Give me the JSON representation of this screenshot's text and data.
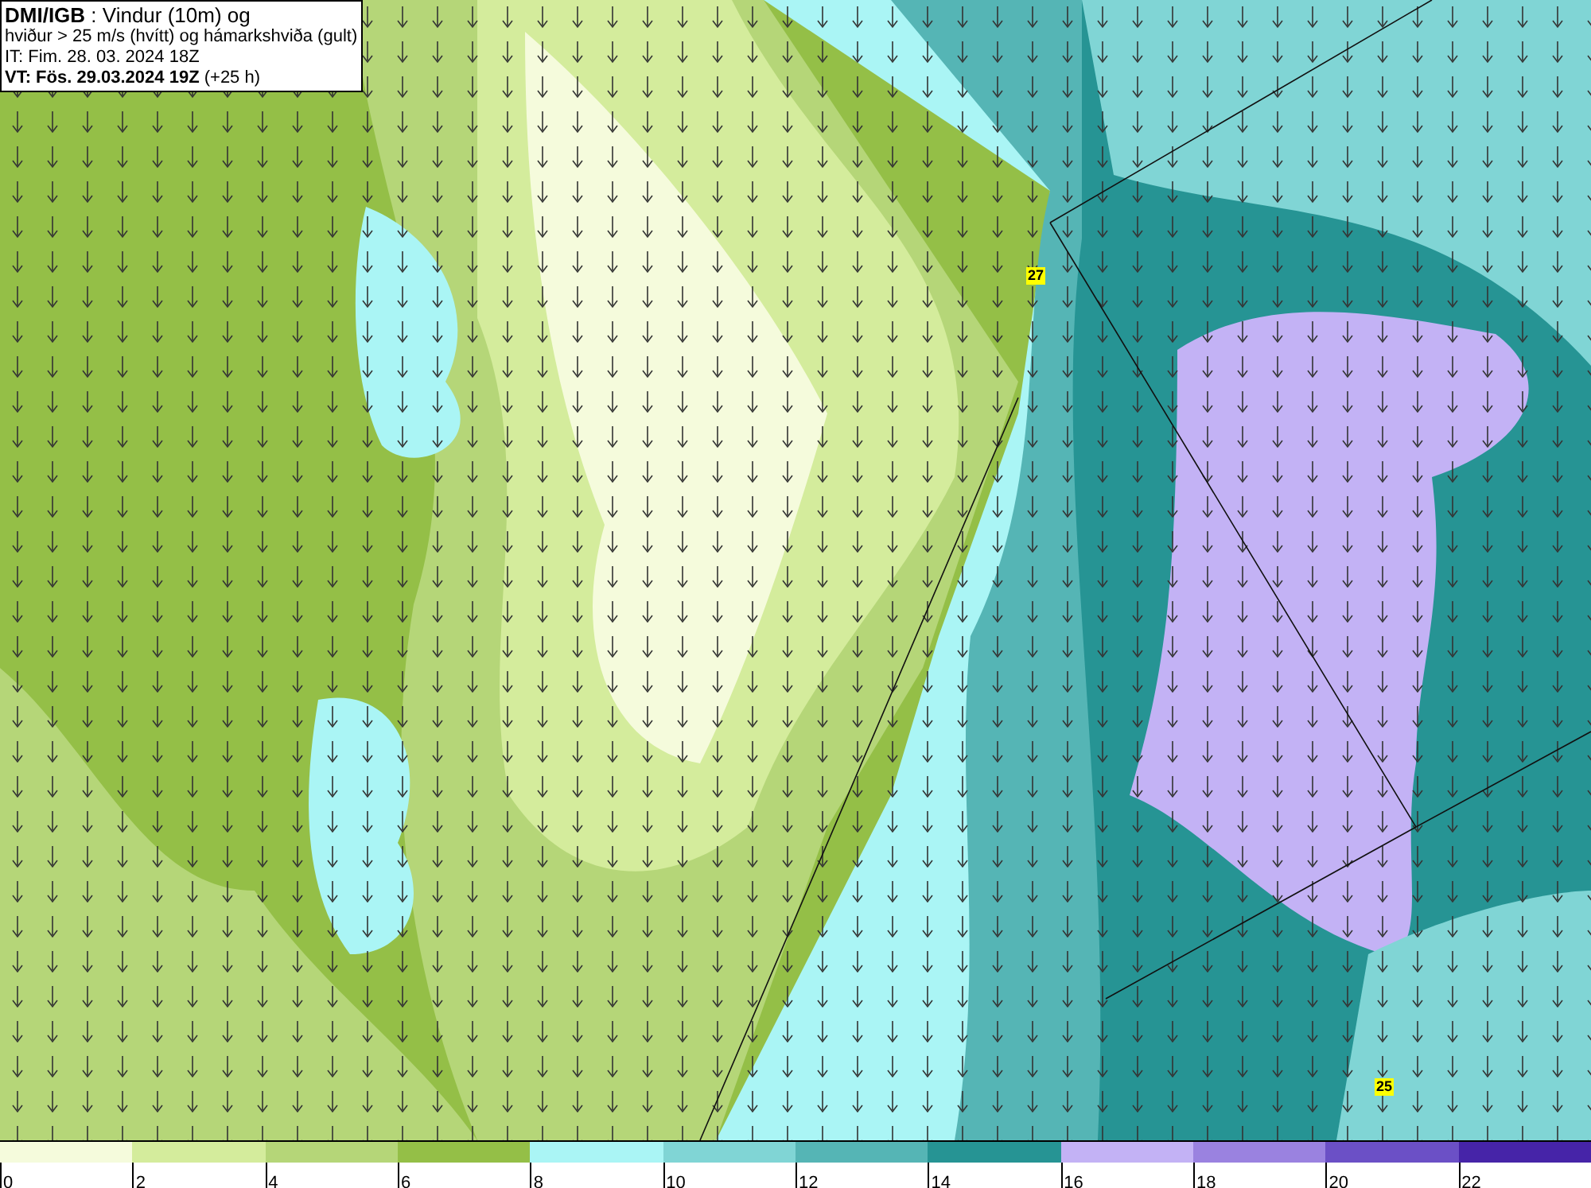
{
  "header": {
    "lines": [
      "**DMI/IGB** : Vindur (10m) og",
      "hviður > 25 m/s (hvítt) og hámarkshviða (gult)",
      "IT: Fim. 28. 03. 2024 18Z",
      "**VT: Fös. 29.03.2024 19Z** (+25 h)"
    ]
  },
  "gust_labels": [
    {
      "value": "27"
    },
    {
      "value": "25"
    }
  ],
  "legend": {
    "segments": [
      {
        "color": "#f5fbdc",
        "label": "0"
      },
      {
        "color": "#d4ec9c",
        "label": "2"
      },
      {
        "color": "#b5d678",
        "label": "4"
      },
      {
        "color": "#94bf47",
        "label": "6"
      },
      {
        "color": "#aaf5f5",
        "label": "8"
      },
      {
        "color": "#80d5d5",
        "label": "10"
      },
      {
        "color": "#55b5b5",
        "label": "12"
      },
      {
        "color": "#269494",
        "label": "14"
      },
      {
        "color": "#c3b2f5",
        "label": "16"
      },
      {
        "color": "#9a82e0",
        "label": "18"
      },
      {
        "color": "#6b50c6",
        "label": "20"
      },
      {
        "color": "#4624a8",
        "label": "22"
      }
    ]
  }
}
